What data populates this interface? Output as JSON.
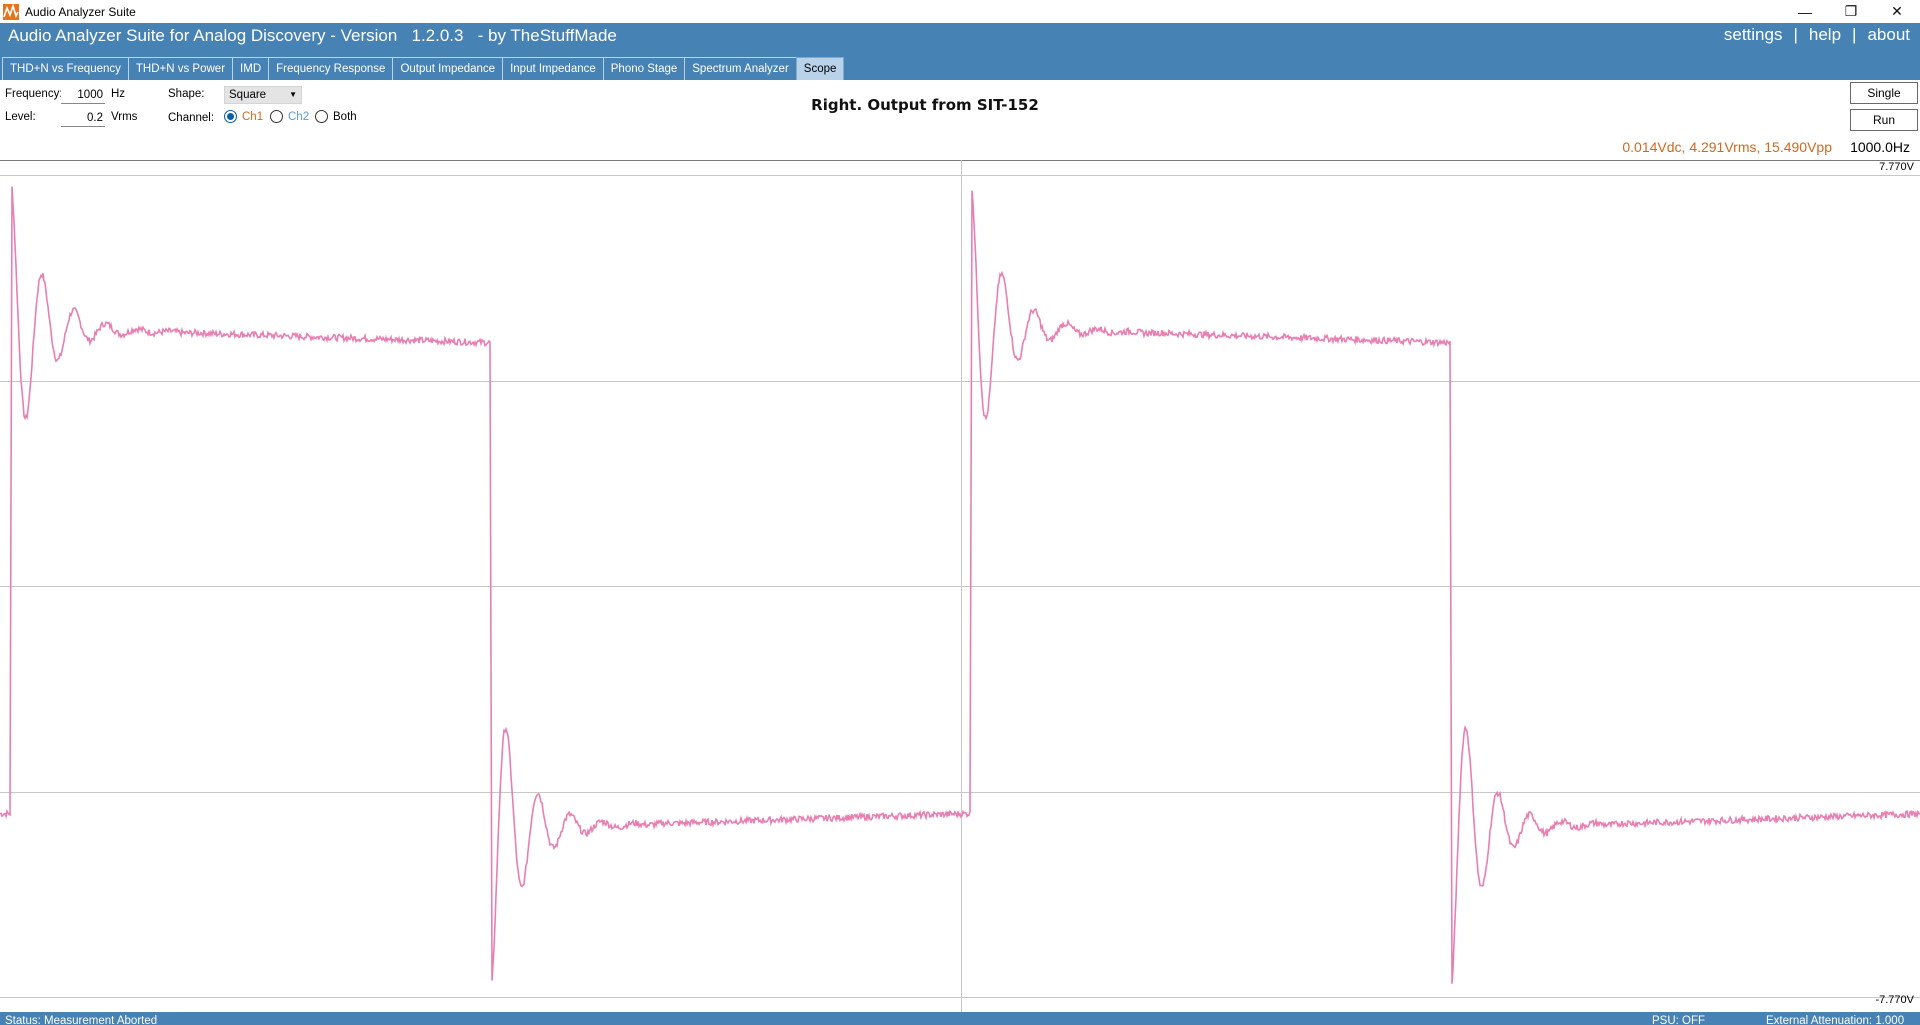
{
  "window": {
    "title": "Audio Analyzer Suite",
    "controls": {
      "minimize": "—",
      "restore": "❐",
      "close": "✕"
    }
  },
  "header": {
    "heading": "Audio Analyzer Suite for Analog Discovery - Version   1.2.0.3   - by TheStuffMade",
    "links": {
      "settings": "settings",
      "help": "help",
      "about": "about",
      "separator": "|"
    }
  },
  "tabs": [
    {
      "label": "THD+N vs Frequency"
    },
    {
      "label": "THD+N vs Power"
    },
    {
      "label": "IMD"
    },
    {
      "label": "Frequency Response"
    },
    {
      "label": "Output Impedance"
    },
    {
      "label": "Input Impedance"
    },
    {
      "label": "Phono Stage"
    },
    {
      "label": "Spectrum Analyzer"
    },
    {
      "label": "Scope",
      "active": true
    }
  ],
  "controls": {
    "frequency_label": "Frequency:",
    "frequency_value": "1000",
    "frequency_unit": "Hz",
    "level_label": "Level:",
    "level_value": "0.2",
    "level_unit": "Vrms",
    "shape_label": "Shape:",
    "shape_value": "Square",
    "channel_label": "Channel:",
    "ch1": "Ch1",
    "ch2": "Ch2",
    "both": "Both",
    "selected_channel": "Ch1",
    "single_button": "Single",
    "run_button": "Run"
  },
  "plot": {
    "title": "Right. Output from SIT-152",
    "readout": "0.014Vdc, 4.291Vrms, 15.490Vpp",
    "frequency_readout": "1000.0Hz",
    "y_max_label": "7.770V",
    "y_min_label": "-7.770V"
  },
  "status": {
    "text": "Status: Measurement Aborted",
    "psu": "PSU: OFF",
    "attenuation": "External Attenuation: 1.000"
  },
  "colors": {
    "header_blue": "#4682b4",
    "trace": "#e97fb0",
    "readout": "#d2691e",
    "ch1": "#d2691e",
    "ch2": "#5b9bd5"
  },
  "chart_data": {
    "type": "line",
    "title": "Right. Output from SIT-152",
    "ylim": [
      -7.77,
      7.77
    ],
    "y_tick_labels": [
      "7.770V",
      "-7.770V"
    ],
    "grid": true,
    "series": [
      {
        "waveform": "square",
        "frequency_hz": 1000,
        "vdc": 0.014,
        "vrms": 4.291,
        "vpp": 15.49,
        "plateau_high_start_v": 4.9,
        "plateau_high_end_v": 4.6,
        "plateau_low_start_v": -4.6,
        "plateau_low_end_v": -4.3,
        "overshoot_peak_v": 7.7,
        "ringing_undershoot_v": 3.2,
        "cycles_shown": 2
      }
    ]
  }
}
